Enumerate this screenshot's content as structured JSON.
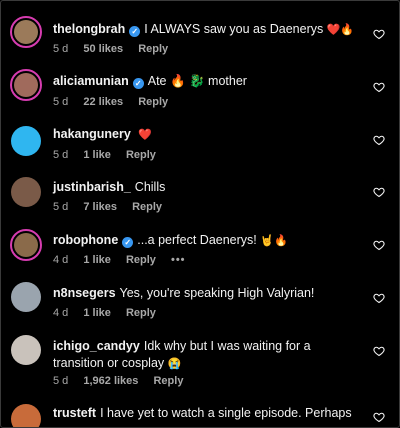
{
  "comments": [
    {
      "username": "thelongbrah",
      "verified": true,
      "text": "I ALWAYS saw you as Daenerys",
      "emoji": "❤️🔥",
      "time": "5 d",
      "likes": "50 likes",
      "reply": "Reply",
      "avatar_color": "#9b7a5a",
      "ring": true
    },
    {
      "username": "aliciamunian",
      "verified": true,
      "text": "Ate 🔥 🐉 mother",
      "emoji": "",
      "time": "5 d",
      "likes": "22 likes",
      "reply": "Reply",
      "avatar_color": "#a06a5c",
      "ring": true
    },
    {
      "username": "hakangunery",
      "verified": false,
      "text": "",
      "emoji": "❤️",
      "time": "5 d",
      "likes": "1 like",
      "reply": "Reply",
      "avatar_color": "#2fb6f0",
      "ring": false
    },
    {
      "username": "justinbarish_",
      "verified": false,
      "text": "Chills",
      "emoji": "",
      "time": "5 d",
      "likes": "7 likes",
      "reply": "Reply",
      "avatar_color": "#7a5a48",
      "ring": false
    },
    {
      "username": "robophone",
      "verified": true,
      "text": "...a perfect Daenerys!",
      "emoji": "🤘🔥",
      "time": "4 d",
      "likes": "1 like",
      "reply": "Reply",
      "more": "•••",
      "avatar_color": "#8a6a4a",
      "ring": true
    },
    {
      "username": "n8nsegers",
      "verified": false,
      "text": "Yes, you're speaking High Valyrian!",
      "emoji": "",
      "time": "4 d",
      "likes": "1 like",
      "reply": "Reply",
      "avatar_color": "#9aa4ae",
      "ring": false
    },
    {
      "username": "ichigo_candyy",
      "verified": false,
      "text": "Idk why but I was waiting for a transition or cosplay",
      "emoji": "😭",
      "time": "5 d",
      "likes": "1,962 likes",
      "reply": "Reply",
      "avatar_color": "#c9c2bb",
      "ring": false
    },
    {
      "username": "trusteft",
      "verified": false,
      "text": "I have yet to watch a single episode. Perhaps I",
      "emoji": "",
      "time": "",
      "likes": "",
      "reply": "",
      "avatar_color": "#c86b3a",
      "ring": false
    }
  ],
  "colors": {
    "background": "#000000",
    "text": "#f2f2f2",
    "meta": "#a8a8a8",
    "verified": "#3897f0",
    "ring": "#d63cb0"
  }
}
